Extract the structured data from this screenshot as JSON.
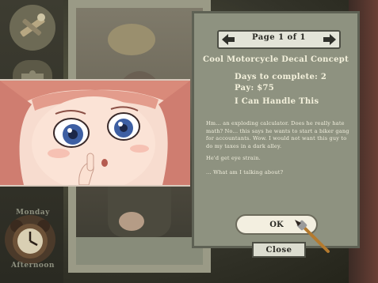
{
  "sidebar": {
    "tools_icon": "tools-icon",
    "puzzle_icon": "puzzle-icon",
    "clock_icon": "alarm-clock-icon",
    "day_label": "Monday",
    "time_label": "Afternoon"
  },
  "job_paper": {
    "page_label": "Page 1 of 1",
    "prev_icon": "arrow-left-icon",
    "next_icon": "arrow-right-icon",
    "title": "Cool Motorcycle Decal Concept",
    "days": "Days to complete: 2",
    "pay": "Pay: $75",
    "attitude": "I Can Handle This",
    "story1": "Hm... an exploding calculator. Does he really hate math? No... this says he wants to start a biker gang for accountants. Wow. I would not want this guy to do my taxes in a dark alley.",
    "story2": "He'd get eye strain.",
    "story3": "... What am I talking about?",
    "ok_label": "OK"
  },
  "close_label": "Close",
  "colors": {
    "paper": "#8e9280",
    "paper_text": "#f4f1dc",
    "button_bg": "#f3efe0"
  }
}
